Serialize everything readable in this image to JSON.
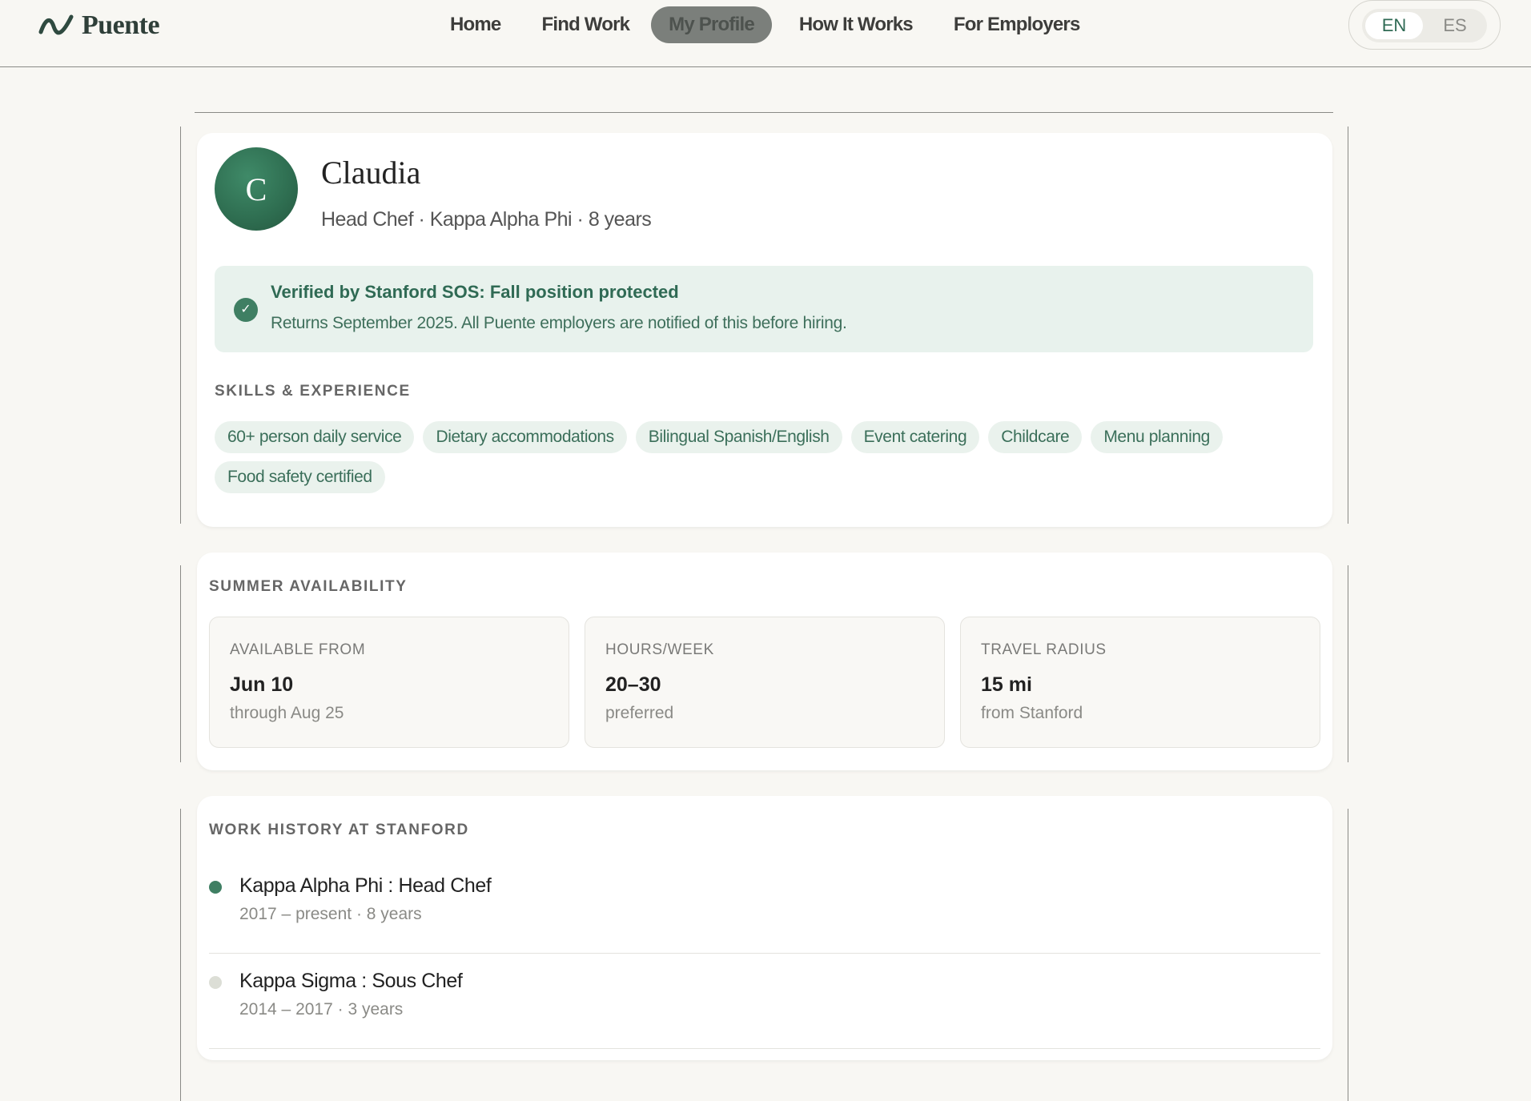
{
  "app": {
    "logo_text": "Puente"
  },
  "nav": {
    "items": [
      {
        "label": "Home",
        "active": false
      },
      {
        "label": "Find Work",
        "active": false
      },
      {
        "label": "My Profile",
        "active": true
      },
      {
        "label": "How It Works",
        "active": false
      },
      {
        "label": "For Employers",
        "active": false
      }
    ]
  },
  "language": {
    "options": [
      "EN",
      "ES"
    ],
    "selected": "EN"
  },
  "profile": {
    "initial": "C",
    "name": "Claudia",
    "subtitle": "Head Chef · Kappa Alpha Phi · 8 years"
  },
  "verification": {
    "title": "Verified by Stanford SOS: Fall position protected",
    "description": "Returns September 2025. All Puente employers are notified of this before hiring."
  },
  "skills": {
    "heading": "SKILLS & EXPERIENCE",
    "items": [
      "60+ person daily service",
      "Dietary accommodations",
      "Bilingual Spanish/English",
      "Event catering",
      "Childcare",
      "Menu planning",
      "Food safety certified"
    ]
  },
  "availability": {
    "heading": "SUMMER AVAILABILITY",
    "boxes": [
      {
        "label": "AVAILABLE FROM",
        "value": "Jun 10",
        "sub": "through Aug 25"
      },
      {
        "label": "HOURS/WEEK",
        "value": "20–30",
        "sub": "preferred"
      },
      {
        "label": "TRAVEL RADIUS",
        "value": "15 mi",
        "sub": "from Stanford"
      }
    ]
  },
  "work_history": {
    "heading": "WORK HISTORY AT STANFORD",
    "items": [
      {
        "title": "Kappa Alpha Phi : Head Chef",
        "meta": "2017 – present · 8 years",
        "dot_color": "#3f7f63"
      },
      {
        "title": "Kappa Sigma : Sous Chef",
        "meta": "2014 – 2017 · 3 years",
        "dot_color": "#dcded6"
      }
    ]
  },
  "colors": {
    "accent": "#2f6a54",
    "background": "#f8f7f3",
    "chip_bg": "#eaf2ed"
  }
}
